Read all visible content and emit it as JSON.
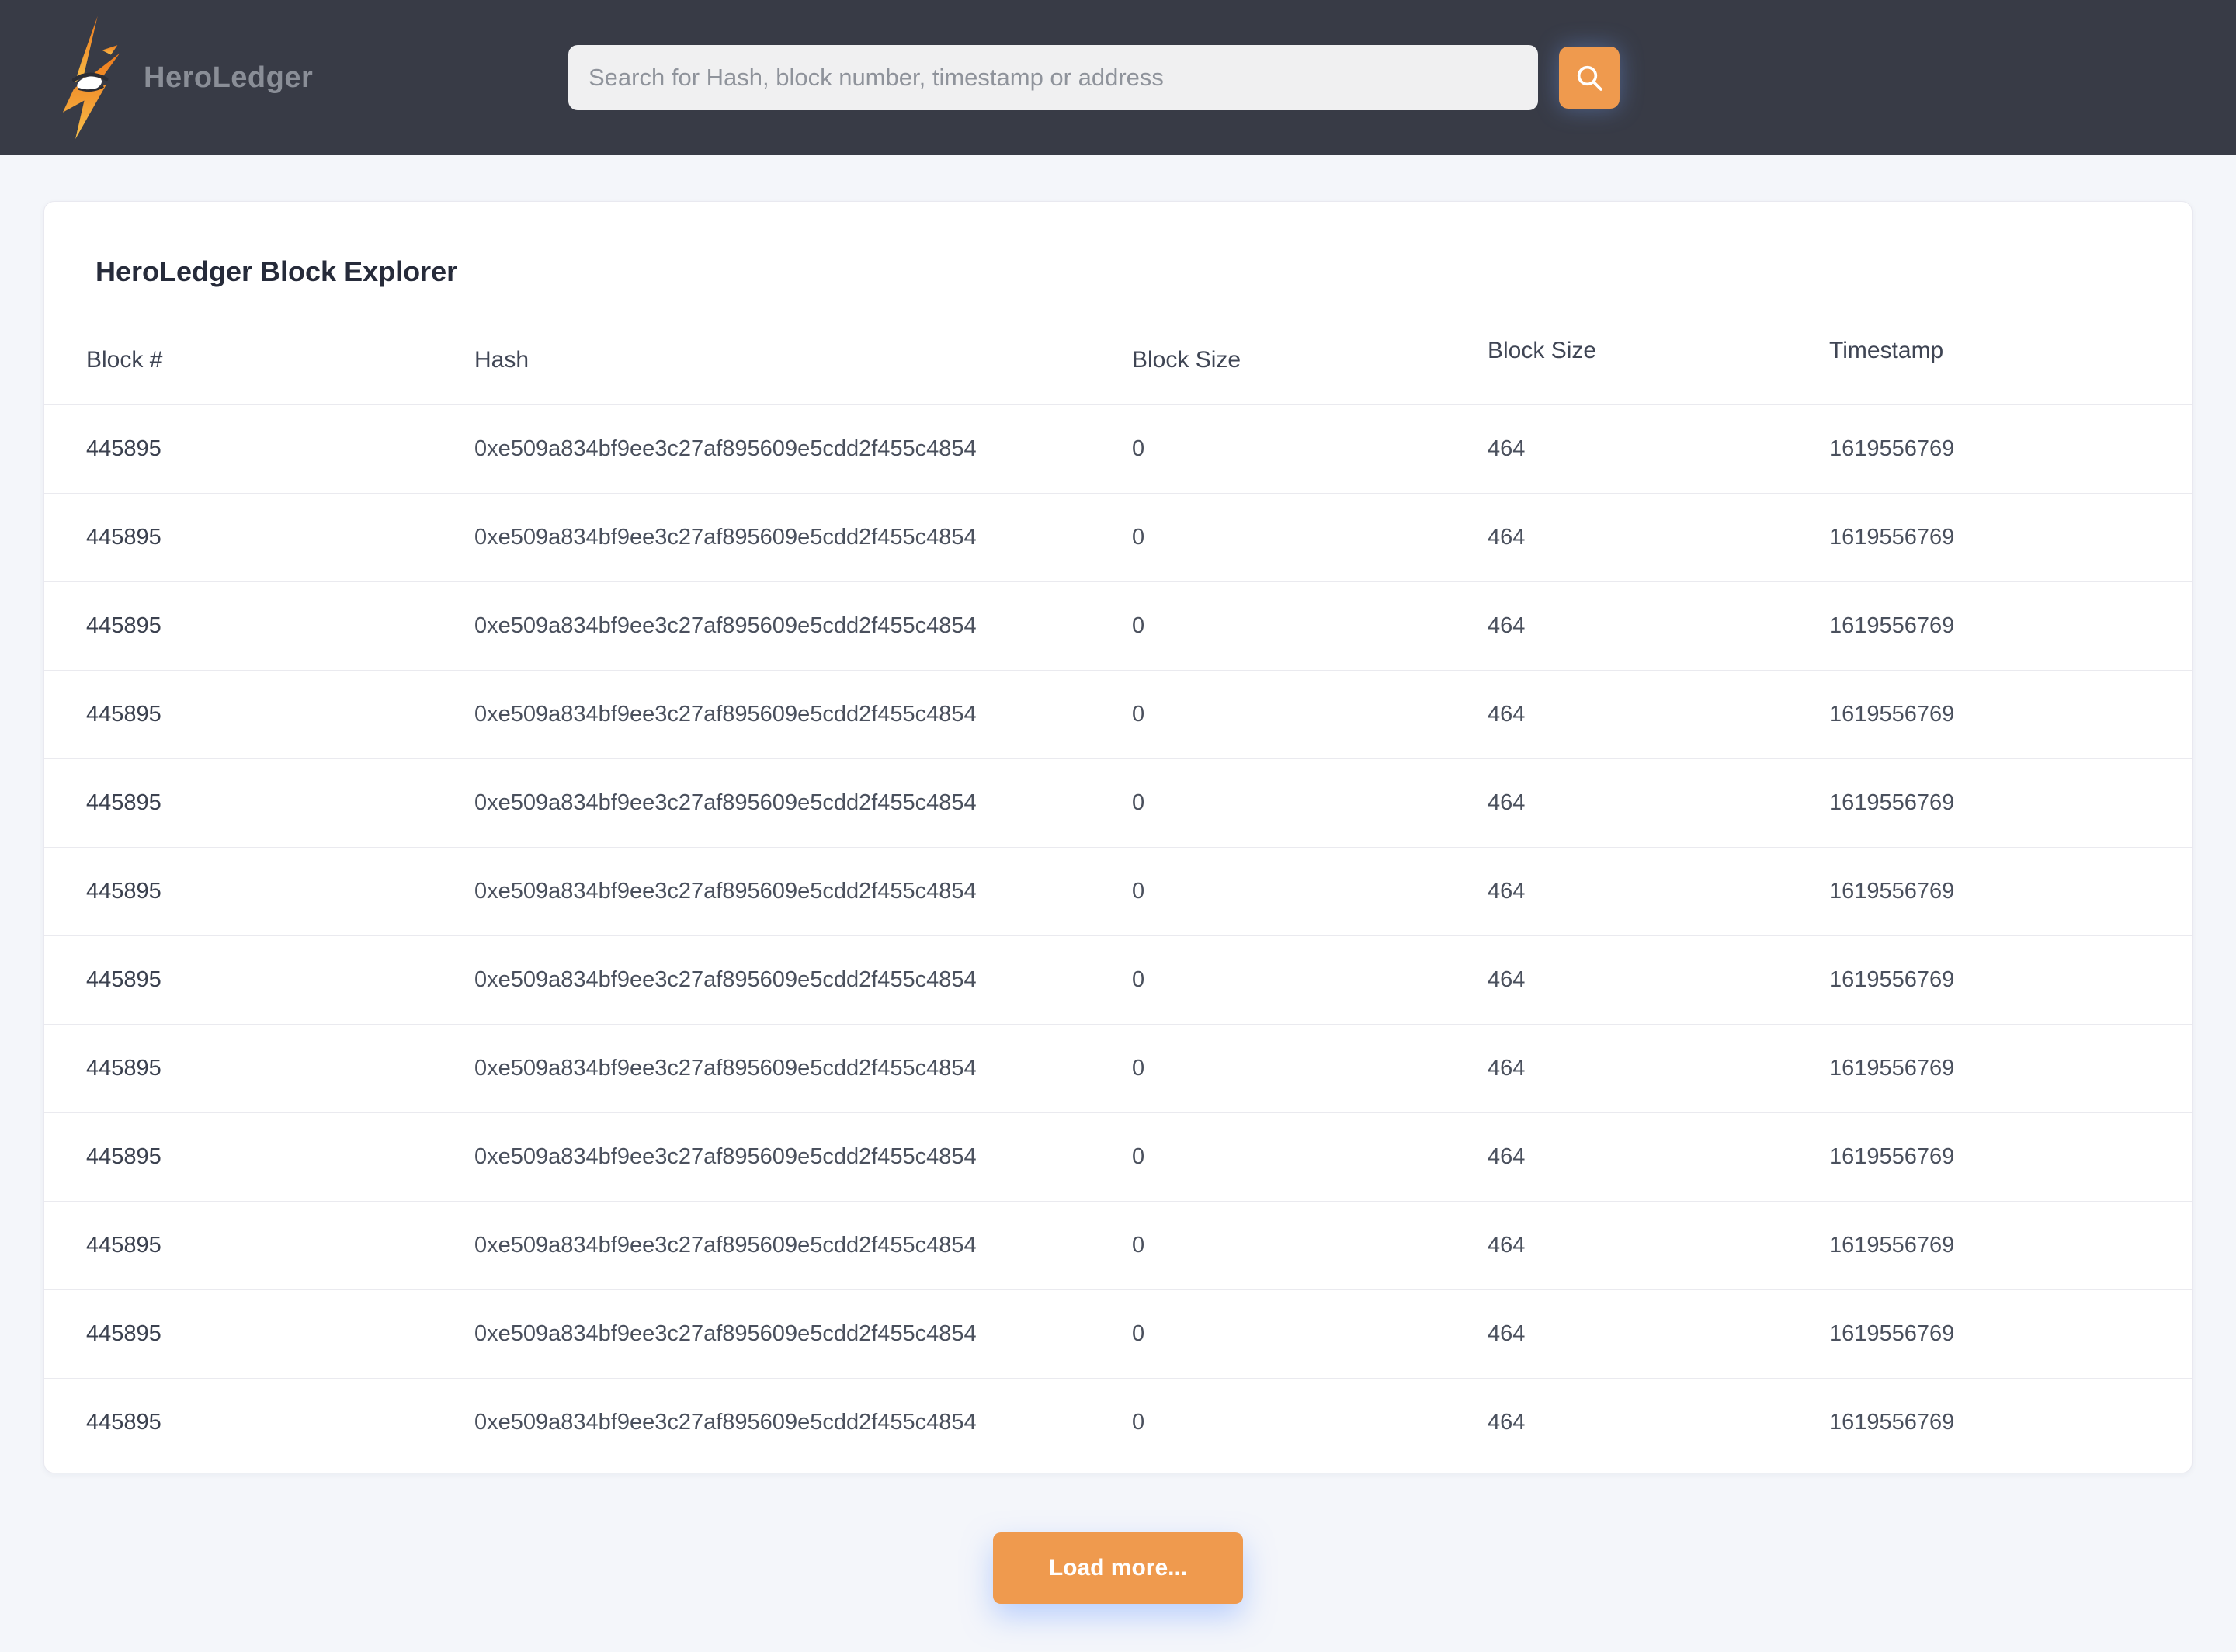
{
  "brand": {
    "name": "HeroLedger"
  },
  "search": {
    "placeholder": "Search for Hash, block number, timestamp or address",
    "button_icon": "search-icon"
  },
  "page": {
    "title": "HeroLedger Block Explorer"
  },
  "table": {
    "columns": [
      "Block #",
      "Hash",
      "Block Size",
      "Block Size",
      "Timestamp"
    ],
    "rows": [
      {
        "block": "445895",
        "hash": "0xe509a834bf9ee3c27af895609e5cdd2f455c4854",
        "size1": "0",
        "size2": "464",
        "timestamp": "1619556769"
      },
      {
        "block": "445895",
        "hash": "0xe509a834bf9ee3c27af895609e5cdd2f455c4854",
        "size1": "0",
        "size2": "464",
        "timestamp": "1619556769"
      },
      {
        "block": "445895",
        "hash": "0xe509a834bf9ee3c27af895609e5cdd2f455c4854",
        "size1": "0",
        "size2": "464",
        "timestamp": "1619556769"
      },
      {
        "block": "445895",
        "hash": "0xe509a834bf9ee3c27af895609e5cdd2f455c4854",
        "size1": "0",
        "size2": "464",
        "timestamp": "1619556769"
      },
      {
        "block": "445895",
        "hash": "0xe509a834bf9ee3c27af895609e5cdd2f455c4854",
        "size1": "0",
        "size2": "464",
        "timestamp": "1619556769"
      },
      {
        "block": "445895",
        "hash": "0xe509a834bf9ee3c27af895609e5cdd2f455c4854",
        "size1": "0",
        "size2": "464",
        "timestamp": "1619556769"
      },
      {
        "block": "445895",
        "hash": "0xe509a834bf9ee3c27af895609e5cdd2f455c4854",
        "size1": "0",
        "size2": "464",
        "timestamp": "1619556769"
      },
      {
        "block": "445895",
        "hash": "0xe509a834bf9ee3c27af895609e5cdd2f455c4854",
        "size1": "0",
        "size2": "464",
        "timestamp": "1619556769"
      },
      {
        "block": "445895",
        "hash": "0xe509a834bf9ee3c27af895609e5cdd2f455c4854",
        "size1": "0",
        "size2": "464",
        "timestamp": "1619556769"
      },
      {
        "block": "445895",
        "hash": "0xe509a834bf9ee3c27af895609e5cdd2f455c4854",
        "size1": "0",
        "size2": "464",
        "timestamp": "1619556769"
      },
      {
        "block": "445895",
        "hash": "0xe509a834bf9ee3c27af895609e5cdd2f455c4854",
        "size1": "0",
        "size2": "464",
        "timestamp": "1619556769"
      },
      {
        "block": "445895",
        "hash": "0xe509a834bf9ee3c27af895609e5cdd2f455c4854",
        "size1": "0",
        "size2": "464",
        "timestamp": "1619556769"
      }
    ]
  },
  "actions": {
    "load_more": "Load more..."
  },
  "colors": {
    "accent_orange": "#ef9a4e",
    "header_bg": "#383b46",
    "page_bg": "#f4f6fa",
    "card_bg": "#ffffff",
    "title_text": "#262b3a",
    "row_separator": "#eaeaef"
  }
}
